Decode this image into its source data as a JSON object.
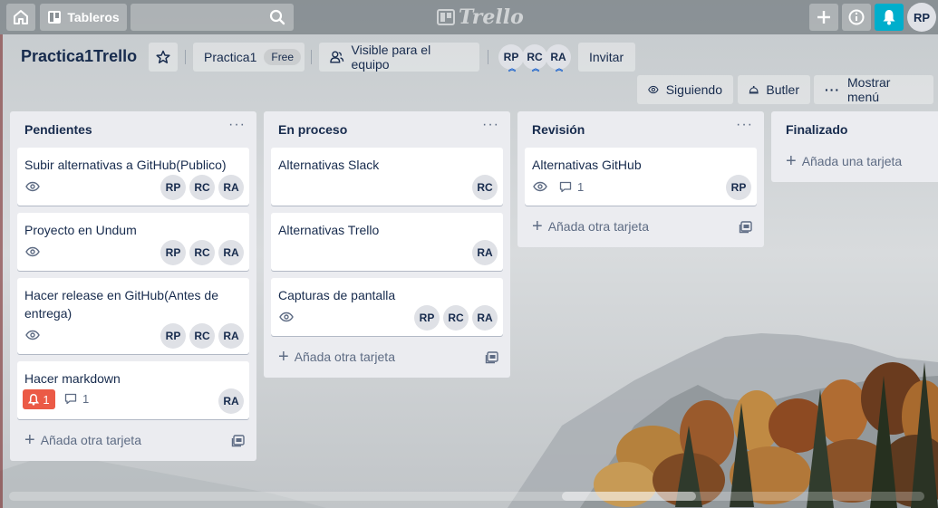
{
  "header": {
    "boards_label": "Tableros",
    "search_value": "",
    "logo_text": "Trello",
    "user_initials": "RP"
  },
  "board": {
    "title": "Practica1Trello",
    "workspace_label": "Practica1",
    "plan_badge": "Free",
    "visibility_label": "Visible para el equipo",
    "members": [
      "RP",
      "RC",
      "RA"
    ],
    "invite_label": "Invitar",
    "following_label": "Siguiendo",
    "butler_label": "Butler",
    "menu_label": "Mostrar menú"
  },
  "lists": [
    {
      "title": "Pendientes",
      "add_label": "Añada otra tarjeta",
      "cards": [
        {
          "title": "Subir alternativas a GitHub(Publico)",
          "watch": true,
          "members": [
            "RP",
            "RC",
            "RA"
          ]
        },
        {
          "title": "Proyecto en Undum",
          "watch": true,
          "members": [
            "RP",
            "RC",
            "RA"
          ]
        },
        {
          "title": "Hacer release en GitHub(Antes de entrega)",
          "watch": true,
          "members": [
            "RP",
            "RC",
            "RA"
          ]
        },
        {
          "title": "Hacer markdown",
          "notifications": "1",
          "comments": "1",
          "members": [
            "RA"
          ]
        }
      ]
    },
    {
      "title": "En proceso",
      "add_label": "Añada otra tarjeta",
      "cards": [
        {
          "title": "Alternativas Slack",
          "members": [
            "RC"
          ]
        },
        {
          "title": "Alternativas Trello",
          "members": [
            "RA"
          ]
        },
        {
          "title": "Capturas de pantalla",
          "watch": true,
          "members": [
            "RP",
            "RC",
            "RA"
          ]
        }
      ]
    },
    {
      "title": "Revisión",
      "add_label": "Añada otra tarjeta",
      "cards": [
        {
          "title": "Alternativas GitHub",
          "watch": true,
          "comments": "1",
          "members": [
            "RP"
          ]
        }
      ]
    },
    {
      "title": "Finalizado",
      "add_label": "Añada una tarjeta",
      "cards": []
    }
  ],
  "colors": {
    "header_bg": "#5a6268",
    "notification_button": "#00aecc",
    "list_bg": "#ebecf0",
    "alert_badge": "#eb5a46",
    "avatar_bg": "#dfe1e6"
  }
}
